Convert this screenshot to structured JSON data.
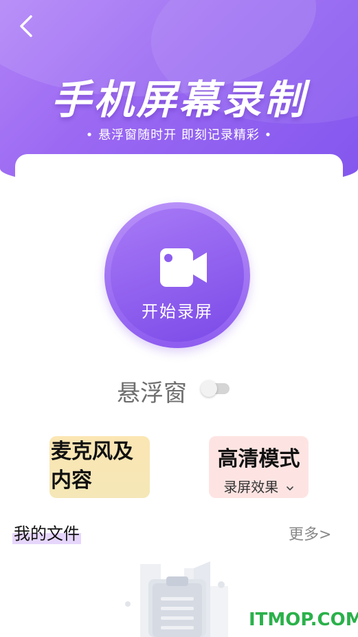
{
  "header": {
    "title": "手机屏幕录制",
    "subtitle": "• 悬浮窗随时开  即刻记录精彩 •"
  },
  "record": {
    "label": "开始录屏",
    "icon": "video-camera-icon"
  },
  "floating_window": {
    "label": "悬浮窗",
    "enabled": false
  },
  "options": {
    "mic": {
      "label": "麦克风及内容"
    },
    "hd": {
      "label": "高清模式",
      "sub_label": "录屏效果"
    }
  },
  "files": {
    "title": "我的文件",
    "more": "更多>"
  },
  "watermark": "ITMOP.COM",
  "colors": {
    "primary": "#8e5df0",
    "mic_card": "#f5e7b7",
    "hd_card": "#fde4e2",
    "watermark": "#2ab14a"
  }
}
